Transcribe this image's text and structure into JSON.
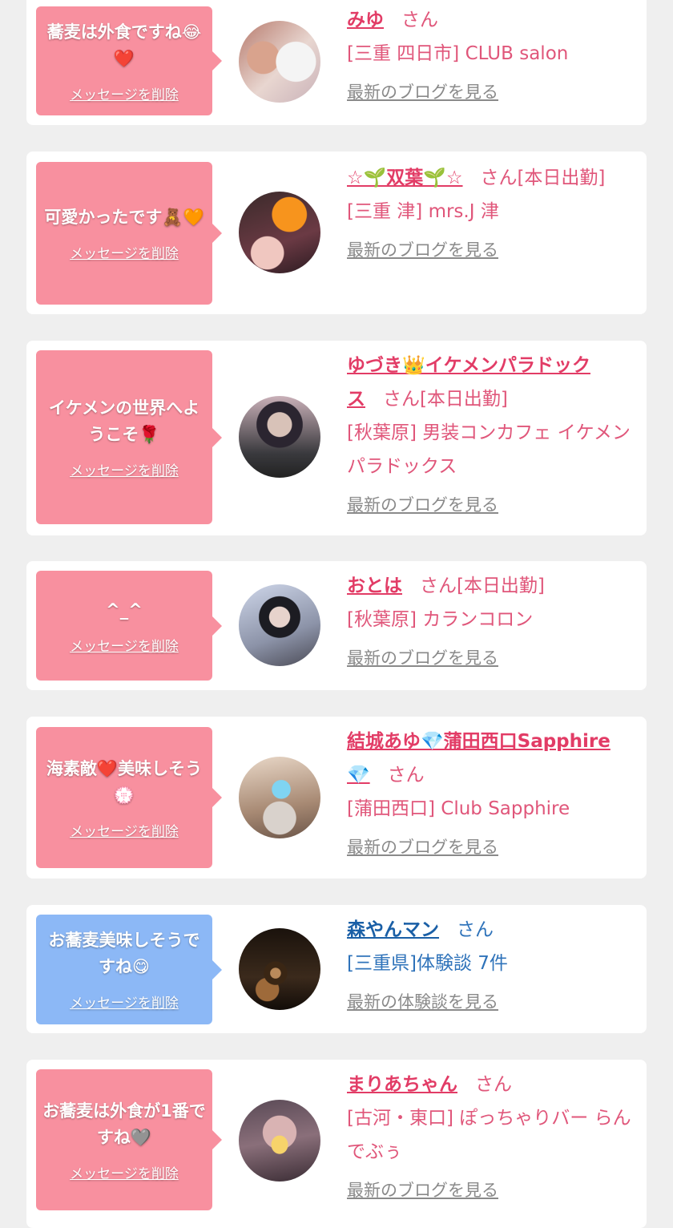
{
  "delete_label": "メッセージを削除",
  "items": [
    {
      "msg": "蕎麦は外食ですね😂❤️",
      "name": "みゆ",
      "suffix": "さん",
      "loc": "[三重 四日市] CLUB salon",
      "link": "最新のブログを見る",
      "theme": "pink"
    },
    {
      "msg": "可愛かったです🧸🧡",
      "name": "☆🌱双葉🌱☆",
      "suffix": "さん[本日出勤]",
      "loc": "[三重 津] mrs.J 津",
      "link": "最新のブログを見る",
      "theme": "pink"
    },
    {
      "msg": "イケメンの世界へようこそ🌹",
      "name": "ゆづき👑イケメンパラドックス",
      "suffix": "さん[本日出勤]",
      "loc": "[秋葉原] 男装コンカフェ イケメンパラドックス",
      "link": "最新のブログを見る",
      "theme": "pink"
    },
    {
      "msg": "^_^",
      "name": "おとは",
      "suffix": "さん[本日出勤]",
      "loc": "[秋葉原] カランコロン",
      "link": "最新のブログを見る",
      "theme": "pink"
    },
    {
      "msg": "海素敵❤️美味しそう💮",
      "name": "結城あゆ💎蒲田西口Sapphire💎",
      "suffix": "さん",
      "loc": "[蒲田西口] Club Sapphire",
      "link": "最新のブログを見る",
      "theme": "pink"
    },
    {
      "msg": "お蕎麦美味しそうですね😋",
      "name": "森やんマン",
      "suffix": "さん",
      "loc": "[三重県]体験談 7件",
      "link": "最新の体験談を見る",
      "theme": "blue"
    },
    {
      "msg": "お蕎麦は外食が1番ですね🩶",
      "name": "まりあちゃん",
      "suffix": "さん",
      "loc": "[古河・東口] ぽっちゃりバー らんでぶぅ",
      "link": "最新のブログを見る",
      "theme": "pink"
    }
  ]
}
